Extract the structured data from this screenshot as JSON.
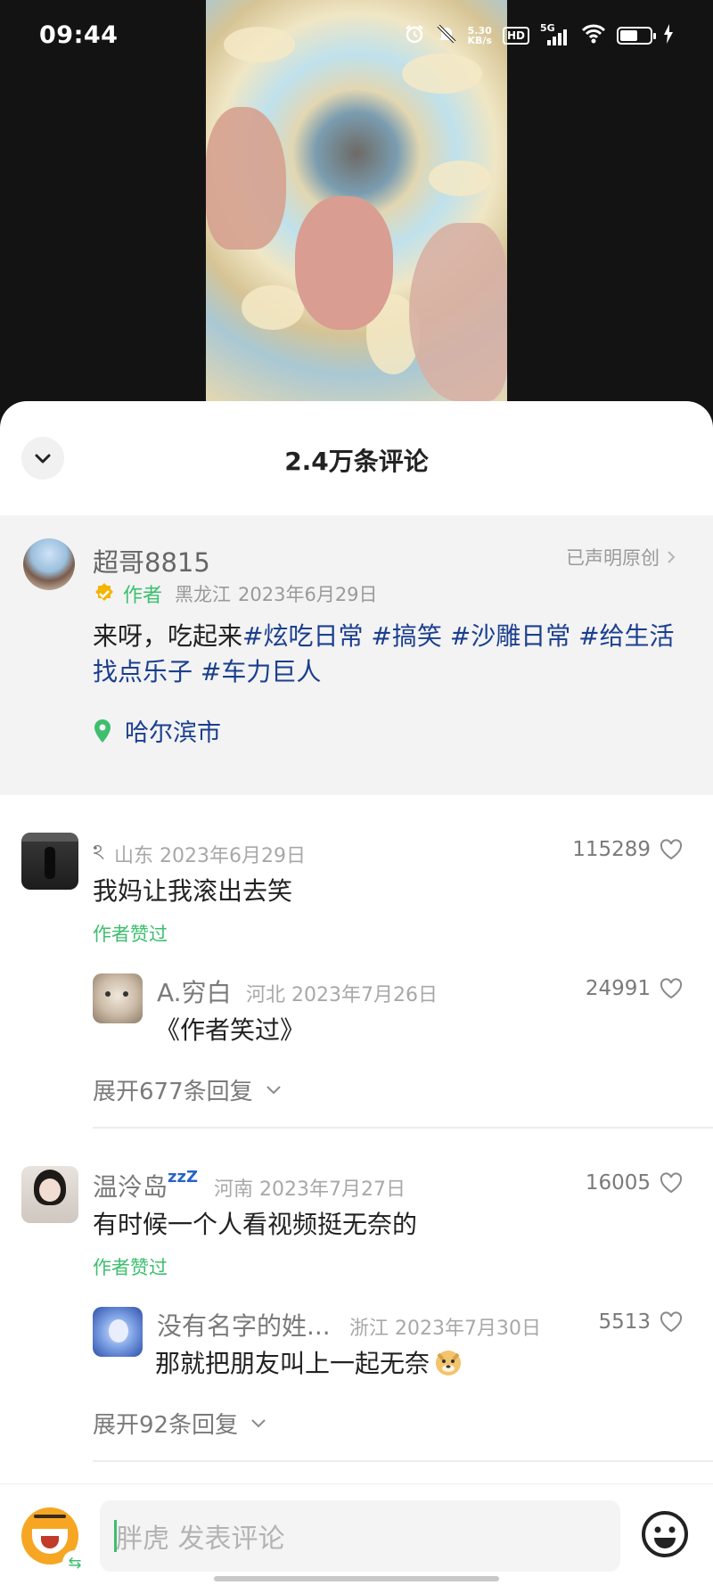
{
  "status_bar": {
    "time": "09:44",
    "net_speed_value": "5.30",
    "net_speed_unit": "KB/s",
    "hd": "HD",
    "network": "5G",
    "icons": [
      "alarm-icon",
      "mute-icon",
      "signal-icon",
      "wifi-icon",
      "battery-icon",
      "charging-icon"
    ],
    "battery_level": 0.6
  },
  "sheet": {
    "title": "2.4万条评论"
  },
  "post": {
    "author_name": "超哥8815",
    "declared_original": "已声明原创",
    "author_tag": "作者",
    "region": "黑龙江",
    "date": "2023年6月29日",
    "text_prefix": "来呀，吃起来",
    "tags_line1": "#炫吃日常 #搞笑 #沙雕日常 #给生活",
    "tags_line2": "找点乐子 #车力巨人",
    "location": "哈尔滨市"
  },
  "comments": [
    {
      "name": "ঽ",
      "region": "山东",
      "date": "2023年6月29日",
      "likes": "115289",
      "text": "我妈让我滚出去笑",
      "liked_by_author": "作者赞过",
      "reply": {
        "name": "A.穷白",
        "region": "河北",
        "date": "2023年7月26日",
        "likes": "24991",
        "text": "《作者笑过》"
      },
      "expand": "展开677条回复"
    },
    {
      "name": "温泠岛",
      "name_suffix": "zzZ",
      "region": "河南",
      "date": "2023年7月27日",
      "likes": "16005",
      "text": "有时候一个人看视频挺无奈的",
      "liked_by_author": "作者赞过",
      "reply": {
        "name": "没有名字的姓...",
        "region": "浙江",
        "date": "2023年7月30日",
        "likes": "5513",
        "text": "那就把朋友叫上一起无奈"
      },
      "expand": "展开92条回复"
    }
  ],
  "bottom_bar": {
    "placeholder": "胖虎 发表评论"
  },
  "colors": {
    "accent_green": "#3dbf6e",
    "hashtag_blue": "#1b3f8f",
    "post_background": "#f3f3f3"
  }
}
